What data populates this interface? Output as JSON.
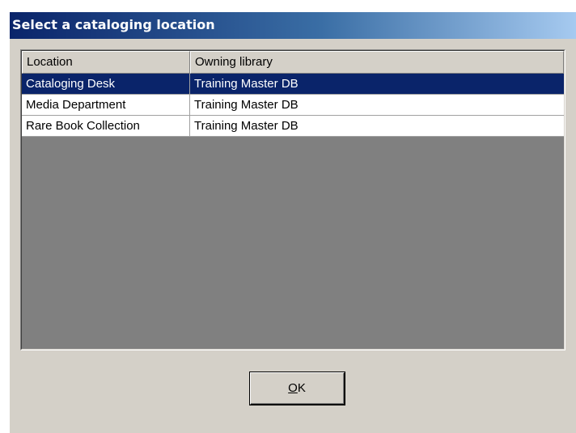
{
  "dialog": {
    "title": "Select a cataloging location"
  },
  "table": {
    "columns": [
      {
        "key": "location",
        "label": "Location"
      },
      {
        "key": "library",
        "label": "Owning library"
      }
    ],
    "rows": [
      {
        "location": "Cataloging Desk",
        "library": "Training Master DB",
        "selected": true
      },
      {
        "location": "Media Department",
        "library": "Training Master DB",
        "selected": false
      },
      {
        "location": "Rare Book Collection",
        "library": "Training Master DB",
        "selected": false
      }
    ]
  },
  "buttons": {
    "ok": {
      "mnemonic": "O",
      "rest": "K"
    }
  },
  "colors": {
    "title_bar_start": "#0a246a",
    "title_bar_end": "#a6caf0",
    "selection": "#0a246a",
    "dialog_face": "#d4d0c8",
    "list_empty_area": "#808080"
  }
}
